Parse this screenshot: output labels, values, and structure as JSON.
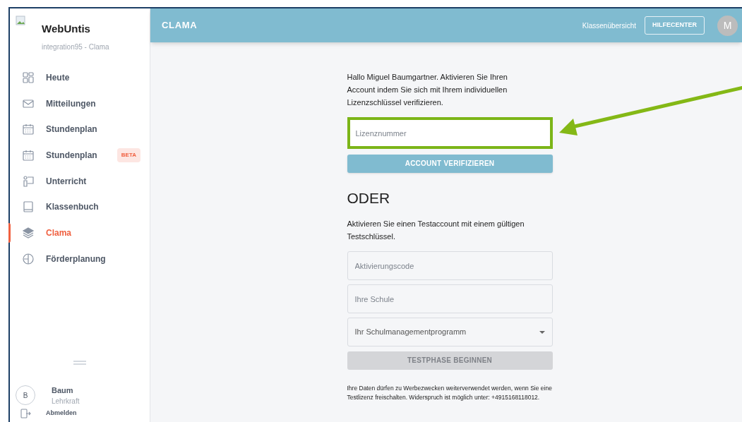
{
  "sidebar": {
    "app_name": "WebUntis",
    "tenant": "integration95 - Clama",
    "items": [
      {
        "label": "Heute",
        "selected": false
      },
      {
        "label": "Mitteilungen",
        "selected": false
      },
      {
        "label": "Stundenplan",
        "selected": false
      },
      {
        "label": "Stundenplan",
        "selected": false,
        "badge": "BETA"
      },
      {
        "label": "Unterricht",
        "selected": false
      },
      {
        "label": "Klassenbuch",
        "selected": false
      },
      {
        "label": "Clama",
        "selected": true
      },
      {
        "label": "Förderplanung",
        "selected": false
      }
    ],
    "user": {
      "initial": "B",
      "name": "Baum",
      "role": "Lehrkraft"
    },
    "logout": "Abmelden"
  },
  "header": {
    "title": "CLAMA",
    "link": "Klassenübersicht",
    "help_button": "HILFECENTER",
    "avatar": "M"
  },
  "form": {
    "intro": "Hallo Miguel Baumgartner. Aktivieren Sie Ihren Account indem Sie sich mit Ihrem individuellen Lizenzschlüssel verifizieren.",
    "license_field": {
      "placeholder": "Lizenznummer",
      "highlighted": true
    },
    "verify_button": {
      "label": "ACCOUNT VERIFIZIEREN",
      "disabled": false
    },
    "or_heading": "ODER",
    "trial_text": "Aktivieren Sie einen Testaccount mit einem gültigen Testschlüssel.",
    "trial_fields": [
      {
        "kind": "text",
        "placeholder": "Aktivierungscode"
      },
      {
        "kind": "text",
        "placeholder": "Ihre Schule"
      },
      {
        "kind": "select",
        "placeholder": "Ihr Schulmanagementprogramm"
      }
    ],
    "trial_button": {
      "label": "TESTPHASE BEGINNEN",
      "disabled": true
    },
    "notice": "Ihre Daten dürfen zu Werbezwecken weiterverwendet werden, wenn Sie eine Testlizenz freischalten. Widerspruch ist möglich unter: +4915168118012."
  }
}
